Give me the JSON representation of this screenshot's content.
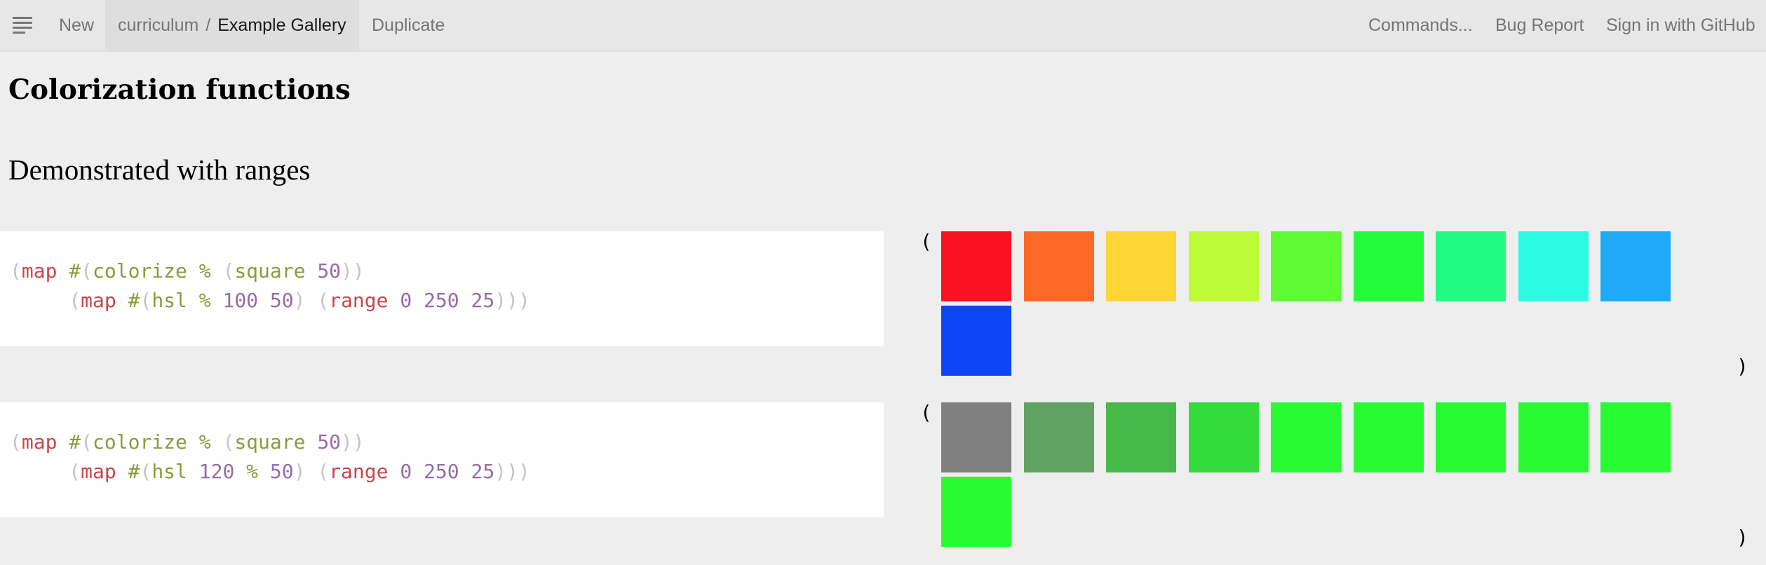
{
  "topbar": {
    "new_label": "New",
    "crumb_parent": "curriculum",
    "crumb_sep": "/",
    "crumb_title": "Example Gallery",
    "duplicate_label": "Duplicate",
    "commands_label": "Commands...",
    "bug_label": "Bug Report",
    "signin_label": "Sign in with GitHub"
  },
  "doc": {
    "heading": "Colorization functions",
    "subheading": "Demonstrated with ranges"
  },
  "cells": [
    {
      "line1": [
        {
          "t": "(",
          "c": "paren"
        },
        {
          "t": "map",
          "c": "kw"
        },
        {
          "t": " #",
          "c": "op"
        },
        {
          "t": "(",
          "c": "paren"
        },
        {
          "t": "colorize",
          "c": "fn"
        },
        {
          "t": " % ",
          "c": "op"
        },
        {
          "t": "(",
          "c": "paren"
        },
        {
          "t": "square",
          "c": "fn"
        },
        {
          "t": " ",
          "c": "op"
        },
        {
          "t": "50",
          "c": "num"
        },
        {
          "t": "))",
          "c": "paren"
        }
      ],
      "line2": [
        {
          "t": "     ",
          "c": "op"
        },
        {
          "t": "(",
          "c": "paren"
        },
        {
          "t": "map",
          "c": "kw"
        },
        {
          "t": " #",
          "c": "op"
        },
        {
          "t": "(",
          "c": "paren"
        },
        {
          "t": "hsl",
          "c": "fn"
        },
        {
          "t": " % ",
          "c": "op"
        },
        {
          "t": "100",
          "c": "num"
        },
        {
          "t": " ",
          "c": "op"
        },
        {
          "t": "50",
          "c": "num"
        },
        {
          "t": ") ",
          "c": "paren"
        },
        {
          "t": "(",
          "c": "paren"
        },
        {
          "t": "range",
          "c": "kw"
        },
        {
          "t": " ",
          "c": "op"
        },
        {
          "t": "0",
          "c": "num"
        },
        {
          "t": " ",
          "c": "op"
        },
        {
          "t": "250",
          "c": "num"
        },
        {
          "t": " ",
          "c": "op"
        },
        {
          "t": "25",
          "c": "num"
        },
        {
          "t": ")))",
          "c": "paren"
        }
      ],
      "open_paren": "(",
      "close_paren": ")",
      "swatches": [
        "#fb1122",
        "#fc6825",
        "#fdd535",
        "#bcfb35",
        "#5efb35",
        "#23fb3b",
        "#21fb84",
        "#2bfbe0",
        "#1eaaf8",
        "#0d44f6"
      ]
    },
    {
      "line1": [
        {
          "t": "(",
          "c": "paren"
        },
        {
          "t": "map",
          "c": "kw"
        },
        {
          "t": " #",
          "c": "op"
        },
        {
          "t": "(",
          "c": "paren"
        },
        {
          "t": "colorize",
          "c": "fn"
        },
        {
          "t": " % ",
          "c": "op"
        },
        {
          "t": "(",
          "c": "paren"
        },
        {
          "t": "square",
          "c": "fn"
        },
        {
          "t": " ",
          "c": "op"
        },
        {
          "t": "50",
          "c": "num"
        },
        {
          "t": "))",
          "c": "paren"
        }
      ],
      "line2": [
        {
          "t": "     ",
          "c": "op"
        },
        {
          "t": "(",
          "c": "paren"
        },
        {
          "t": "map",
          "c": "kw"
        },
        {
          "t": " #",
          "c": "op"
        },
        {
          "t": "(",
          "c": "paren"
        },
        {
          "t": "hsl",
          "c": "fn"
        },
        {
          "t": " ",
          "c": "op"
        },
        {
          "t": "120",
          "c": "num"
        },
        {
          "t": " % ",
          "c": "op"
        },
        {
          "t": "50",
          "c": "num"
        },
        {
          "t": ") ",
          "c": "paren"
        },
        {
          "t": "(",
          "c": "paren"
        },
        {
          "t": "range",
          "c": "kw"
        },
        {
          "t": " ",
          "c": "op"
        },
        {
          "t": "0",
          "c": "num"
        },
        {
          "t": " ",
          "c": "op"
        },
        {
          "t": "250",
          "c": "num"
        },
        {
          "t": " ",
          "c": "op"
        },
        {
          "t": "25",
          "c": "num"
        },
        {
          "t": ")))",
          "c": "paren"
        }
      ],
      "open_paren": "(",
      "close_paren": ")",
      "swatches": [
        "#808080",
        "#61a162",
        "#47b94a",
        "#33dc3a",
        "#28fb31",
        "#28fb31",
        "#28fb31",
        "#28fb31",
        "#28fb31",
        "#28fb31"
      ]
    }
  ]
}
